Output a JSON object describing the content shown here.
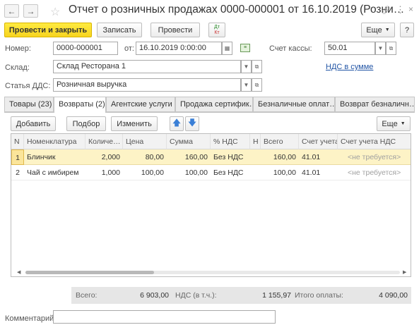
{
  "window": {
    "title": "Отчет о розничных продажах 0000-000001 от 16.10.2019 (Розни…",
    "back_icon": "←",
    "forward_icon": "→",
    "star_icon": "☆"
  },
  "toolbar": {
    "post_close": "Провести и закрыть",
    "save": "Записать",
    "post": "Провести",
    "dtkt_top": "Дт",
    "dtkt_bottom": "Кт",
    "more": "Еще",
    "help": "?"
  },
  "form": {
    "number_label": "Номер:",
    "number": "0000-000001",
    "date_label": "от:",
    "date": "16.10.2019  0:00:00",
    "account_label": "Счет кассы:",
    "account": "50.01",
    "warehouse_label": "Склад:",
    "warehouse": "Склад Ресторана 1",
    "vat_link": "НДС в сумме",
    "dds_label": "Статья ДДС:",
    "dds": "Розничная выручка"
  },
  "tabs": [
    {
      "label": "Товары (23)"
    },
    {
      "label": "Возвраты (2)"
    },
    {
      "label": "Агентские услуги"
    },
    {
      "label": "Продажа сертифик…"
    },
    {
      "label": "Безналичные оплат…"
    },
    {
      "label": "Возврат безналичн…"
    }
  ],
  "table_toolbar": {
    "add": "Добавить",
    "pick": "Подбор",
    "change": "Изменить",
    "more": "Еще"
  },
  "table": {
    "columns": [
      "N",
      "Номенклатура",
      "Количе…",
      "Цена",
      "Сумма",
      "% НДС",
      "Н",
      "Всего",
      "Счет учета",
      "Счет учета НДС"
    ],
    "rows": [
      [
        "1",
        "Блинчик",
        "2,000",
        "80,00",
        "160,00",
        "Без НДС",
        "",
        "160,00",
        "41.01",
        "<не требуется>"
      ],
      [
        "2",
        "Чай с имбирем",
        "1,000",
        "100,00",
        "100,00",
        "Без НДС",
        "",
        "100,00",
        "41.01",
        "<не требуется>"
      ]
    ]
  },
  "totals": {
    "total_label": "Всего:",
    "total": "6 903,00",
    "vat_label": "НДС (в т.ч.):",
    "vat": "1 155,97",
    "paid_label": "Итого оплаты:",
    "paid": "4 090,00"
  },
  "comment_label": "Комментарий:",
  "colors": {
    "accent_yellow": "#f7d420",
    "selected_row": "#fdf3c6",
    "link": "#2255a5",
    "arrow_blue": "#3a7fd6"
  }
}
